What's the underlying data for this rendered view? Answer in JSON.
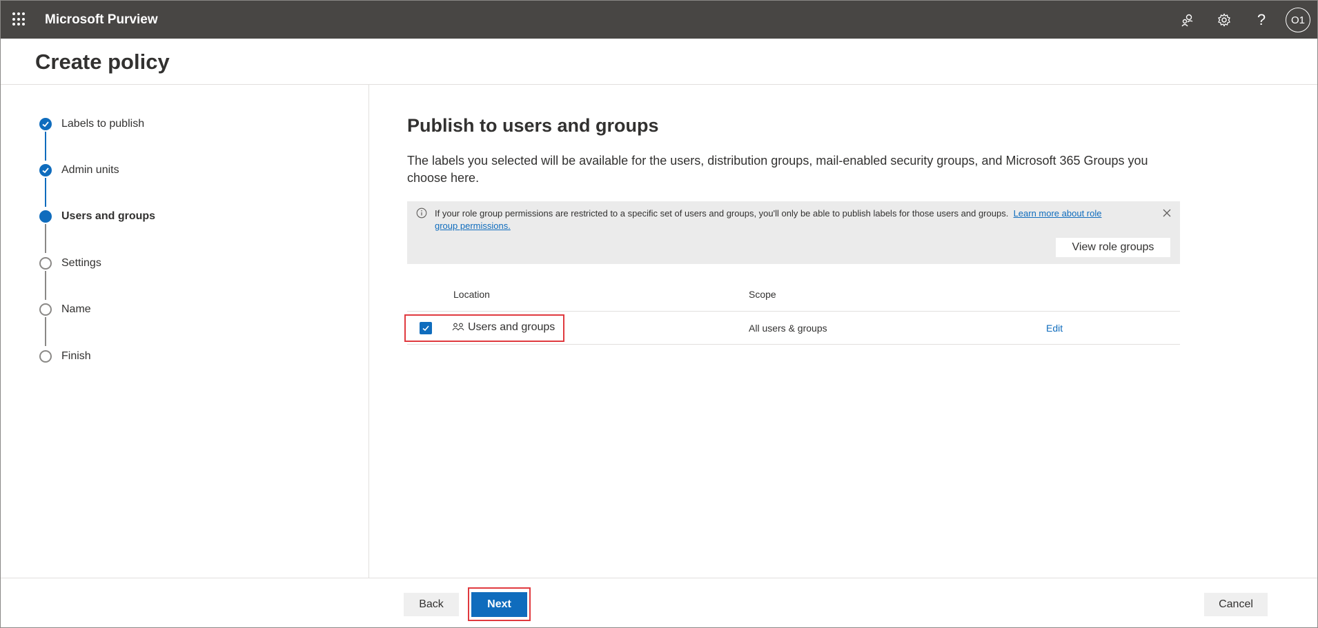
{
  "app": {
    "title": "Microsoft Purview",
    "avatar_initials": "O1"
  },
  "topbar": {
    "icons": [
      "community-icon",
      "gear-icon",
      "help-icon"
    ]
  },
  "page": {
    "title": "Create policy"
  },
  "steps": [
    {
      "label": "Labels to publish",
      "state": "done"
    },
    {
      "label": "Admin units",
      "state": "done"
    },
    {
      "label": "Users and groups",
      "state": "current"
    },
    {
      "label": "Settings",
      "state": "todo"
    },
    {
      "label": "Name",
      "state": "todo"
    },
    {
      "label": "Finish",
      "state": "todo"
    }
  ],
  "main": {
    "title": "Publish to users and groups",
    "description": "The labels you selected will be available for the users, distribution groups, mail-enabled security groups, and Microsoft 365 Groups you choose here.",
    "info": {
      "text": "If your role group permissions are restricted to a specific set of users and groups, you'll only be able to publish labels for those users and groups.",
      "link": "Learn more about role group permissions.",
      "button": "View role groups"
    },
    "table": {
      "headers": {
        "location": "Location",
        "scope": "Scope"
      },
      "rows": [
        {
          "location": "Users and groups",
          "scope": "All users & groups",
          "action": "Edit",
          "checked": true
        }
      ]
    }
  },
  "footer": {
    "back": "Back",
    "next": "Next",
    "cancel": "Cancel"
  },
  "colors": {
    "accent": "#0f6cbd",
    "topbar": "#484644",
    "highlight": "#e0393e"
  }
}
